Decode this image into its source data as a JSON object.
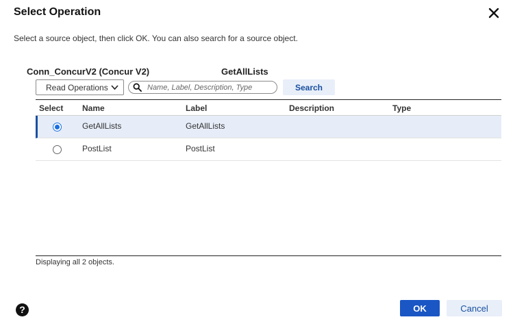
{
  "dialog": {
    "title": "Select Operation",
    "subtitle": "Select a source object, then click OK. You can also search for a source object."
  },
  "connection": {
    "name": "Conn_ConcurV2 (Concur V2)",
    "selected_operation": "GetAllLists"
  },
  "filter": {
    "operation_type": "Read Operations",
    "search_placeholder": "Name, Label, Description, Type",
    "search_value": "",
    "search_button": "Search"
  },
  "table": {
    "headers": {
      "select": "Select",
      "name": "Name",
      "label": "Label",
      "description": "Description",
      "type": "Type"
    },
    "rows": [
      {
        "name": "GetAllLists",
        "label": "GetAllLists",
        "description": "",
        "type": "",
        "selected": true
      },
      {
        "name": "PostList",
        "label": "PostList",
        "description": "",
        "type": "",
        "selected": false
      }
    ]
  },
  "status_text": "Displaying all 2 objects.",
  "buttons": {
    "ok": "OK",
    "cancel": "Cancel",
    "help": "?"
  },
  "icons": {
    "close": "close-icon",
    "dropdown": "chevron-down-icon",
    "search": "search-icon",
    "help": "help-icon"
  },
  "colors": {
    "accent": "#1a56c4",
    "selected_row_bg": "#e6edf8",
    "secondary_button_bg": "#e8eff9"
  }
}
